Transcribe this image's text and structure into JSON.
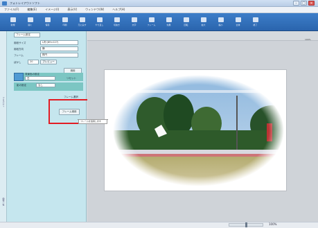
{
  "window": {
    "title": "フォトレイアウトソフト",
    "controls": {
      "minimize": "–",
      "maximize": "□",
      "close": "×"
    }
  },
  "menu": [
    "ファイル(F)",
    "編集(E)",
    "イメージ(I)",
    "表示(V)",
    "ウィンドウ(W)",
    "ヘルプ(H)"
  ],
  "toolbar": [
    {
      "label": "新規",
      "icon": "new-file-icon"
    },
    {
      "label": "開く",
      "icon": "open-folder-icon"
    },
    {
      "label": "保存",
      "icon": "save-icon"
    },
    {
      "label": "印刷",
      "icon": "print-icon"
    },
    {
      "label": "元に戻す",
      "icon": "undo-icon"
    },
    {
      "label": "やり直し",
      "icon": "redo-icon"
    },
    {
      "label": "切抜き",
      "icon": "crop-icon"
    },
    {
      "label": "文字",
      "icon": "text-icon"
    },
    {
      "label": "フレーム",
      "icon": "frame-icon"
    },
    {
      "label": "効果",
      "icon": "effect-icon"
    },
    {
      "label": "回転",
      "icon": "rotate-icon"
    },
    {
      "label": "拡大",
      "icon": "zoom-in-icon"
    },
    {
      "label": "縮小",
      "icon": "zoom-out-icon"
    },
    {
      "label": "全体",
      "icon": "fit-icon"
    },
    {
      "label": "終了",
      "icon": "exit-icon"
    }
  ],
  "panel": {
    "header": "フレーム設定",
    "rows": [
      {
        "label": "用紙サイズ",
        "value": "L判 (89×127)"
      },
      {
        "label": "用紙方向",
        "value": "横"
      },
      {
        "label": "フレーム",
        "value": "楕円"
      },
      {
        "label": "ぼかし",
        "value": "20"
      }
    ],
    "sample_button": "プレビュー",
    "color_label": "背景色の設定",
    "color_value": "白",
    "reset_label": "リセット",
    "shadow_label": "影の設定",
    "shadow_value": "なし",
    "apply_button": "適用",
    "frame_select_label": "フレーム選択",
    "frame_apply_button": "フレーム適用",
    "side_tab": "プロパティ",
    "side_tab_bottom": "画像一覧"
  },
  "workspace": {
    "label": "100%",
    "callout": "フレームを適用します"
  },
  "status": {
    "text": "100%"
  }
}
